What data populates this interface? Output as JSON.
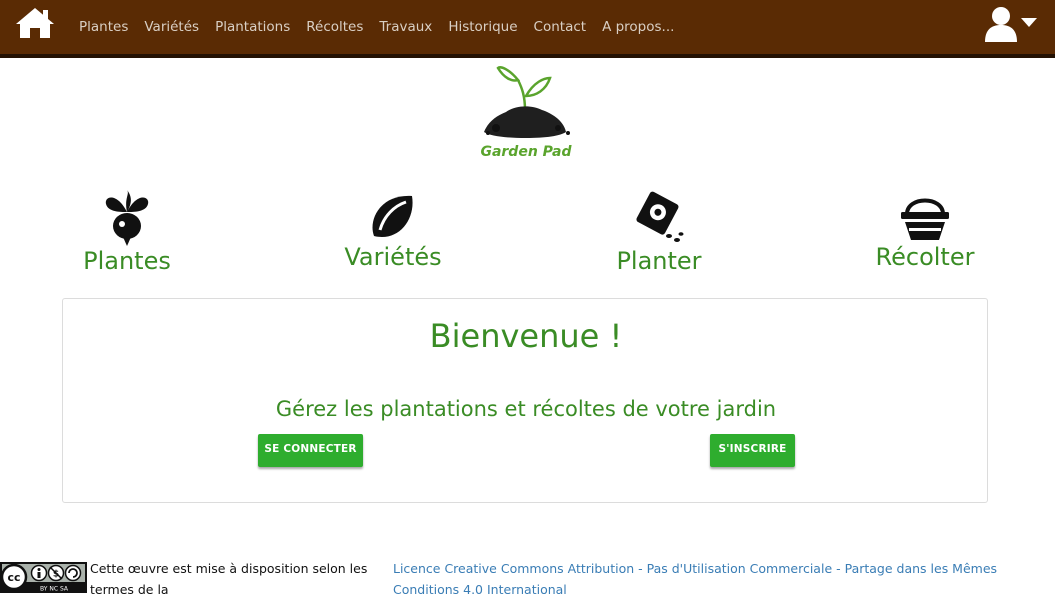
{
  "nav": {
    "home_icon": "home-icon",
    "items": [
      "Plantes",
      "Variétés",
      "Plantations",
      "Récoltes",
      "Travaux",
      "Historique",
      "Contact",
      "A propos..."
    ],
    "user_icon": "user-icon",
    "background": "#5a2b04"
  },
  "logo": {
    "text": "Garden Pad",
    "color": "#5aa42d"
  },
  "features": [
    {
      "label": "Plantes",
      "icon": "radish-icon"
    },
    {
      "label": "Variétés",
      "icon": "seed-icon"
    },
    {
      "label": "Planter",
      "icon": "seed-packet-icon"
    },
    {
      "label": "Récolter",
      "icon": "basket-icon"
    }
  ],
  "welcome": {
    "title": "Bienvenue !",
    "subtitle": "Gérez les plantations et récoltes de votre jardin",
    "login_button": "SE CONNECTER",
    "signup_button": "S'INSCRIRE",
    "accent": "#3a8c25",
    "button_color": "#2ead2e"
  },
  "footer": {
    "badge_text": "BY NC SA",
    "text": "Cette œuvre est mise à disposition selon les termes de la",
    "link": "Licence Creative Commons Attribution - Pas d'Utilisation Commerciale - Partage dans les Mêmes Conditions 4.0 International",
    "link_color": "#3a7db5"
  }
}
